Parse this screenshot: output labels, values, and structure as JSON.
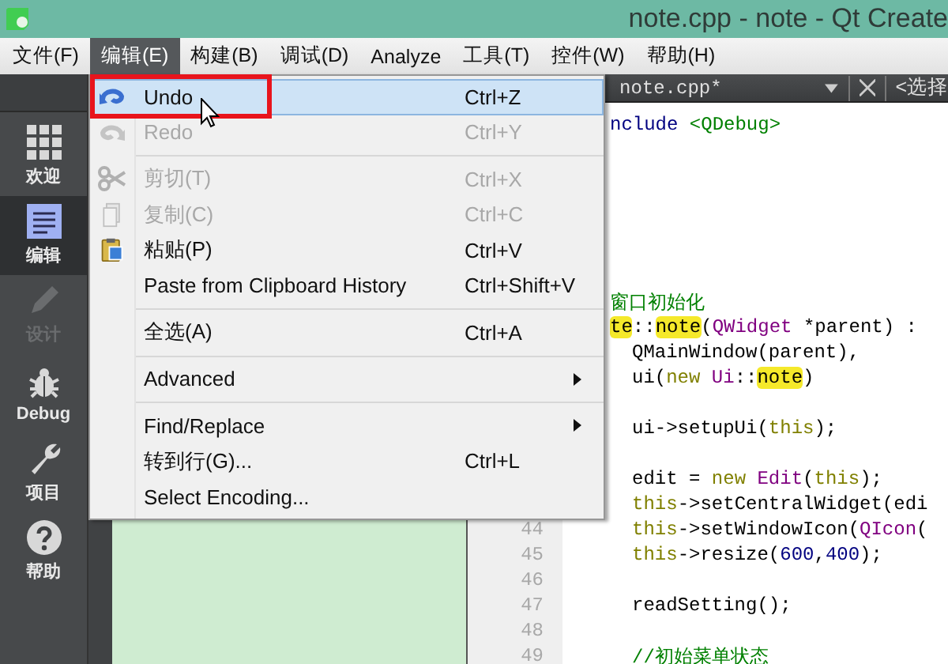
{
  "window": {
    "title": "note.cpp - note - Qt Create"
  },
  "menubar": [
    {
      "label": "文件(F)",
      "selected": false
    },
    {
      "label": "编辑(E)",
      "selected": true
    },
    {
      "label": "构建(B)",
      "selected": false
    },
    {
      "label": "调试(D)",
      "selected": false
    },
    {
      "label": "Analyze",
      "selected": false
    },
    {
      "label": "工具(T)",
      "selected": false
    },
    {
      "label": "控件(W)",
      "selected": false
    },
    {
      "label": "帮助(H)",
      "selected": false
    }
  ],
  "sidebar": [
    {
      "label": "欢迎",
      "selected": false,
      "disabled": false
    },
    {
      "label": "编辑",
      "selected": true,
      "disabled": false
    },
    {
      "label": "设计",
      "selected": false,
      "disabled": true
    },
    {
      "label": "Debug",
      "selected": false,
      "disabled": false
    },
    {
      "label": "项目",
      "selected": false,
      "disabled": false
    },
    {
      "label": "帮助",
      "selected": false,
      "disabled": false
    }
  ],
  "editor_toolbar": {
    "file": "note.cpp*",
    "symbol": "<选择"
  },
  "code_lines": [
    {
      "kind": "code",
      "segments": [
        {
          "kind": "preproc",
          "text": "nclude "
        },
        {
          "kind": "string",
          "text": "<QDebug>"
        }
      ]
    },
    {
      "kind": "blank"
    },
    {
      "kind": "blank"
    },
    {
      "kind": "blank"
    },
    {
      "kind": "blank"
    },
    {
      "kind": "blank"
    },
    {
      "kind": "blank"
    },
    {
      "kind": "code",
      "segments": [
        {
          "kind": "comment",
          "text": "窗口初始化"
        }
      ]
    },
    {
      "kind": "code",
      "segments": [
        {
          "kind": "match",
          "text": "te"
        },
        {
          "kind": "plain",
          "text": "::"
        },
        {
          "kind": "match",
          "text": "note"
        },
        {
          "kind": "plain",
          "text": "("
        },
        {
          "kind": "type",
          "text": "QWidget"
        },
        {
          "kind": "plain",
          "text": " *parent) :"
        }
      ]
    },
    {
      "kind": "indented",
      "segments": [
        {
          "kind": "plain",
          "text": "QMainWindow(parent),"
        }
      ]
    },
    {
      "kind": "indented",
      "segments": [
        {
          "kind": "plain",
          "text": "ui("
        },
        {
          "kind": "keyword",
          "text": "new "
        },
        {
          "kind": "type",
          "text": "Ui"
        },
        {
          "kind": "plain",
          "text": "::"
        },
        {
          "kind": "match",
          "text": "note"
        },
        {
          "kind": "plain",
          "text": ")"
        }
      ]
    },
    {
      "kind": "blank"
    },
    {
      "kind": "indented",
      "segments": [
        {
          "kind": "plain",
          "text": "ui->setupUi("
        },
        {
          "kind": "keyword",
          "text": "this"
        },
        {
          "kind": "plain",
          "text": ");"
        }
      ]
    },
    {
      "kind": "blank"
    },
    {
      "kind": "indented",
      "segments": [
        {
          "kind": "plain",
          "text": "edit = "
        },
        {
          "kind": "keyword",
          "text": "new "
        },
        {
          "kind": "type",
          "text": "Edit"
        },
        {
          "kind": "plain",
          "text": "("
        },
        {
          "kind": "keyword",
          "text": "this"
        },
        {
          "kind": "plain",
          "text": ");"
        }
      ]
    },
    {
      "kind": "indented",
      "segments": [
        {
          "kind": "keyword",
          "text": "this"
        },
        {
          "kind": "plain",
          "text": "->setCentralWidget(edi"
        }
      ]
    },
    {
      "kind": "indented",
      "number": "44",
      "segments": [
        {
          "kind": "keyword",
          "text": "this"
        },
        {
          "kind": "plain",
          "text": "->setWindowIcon("
        },
        {
          "kind": "type",
          "text": "QIcon"
        },
        {
          "kind": "plain",
          "text": "("
        }
      ]
    },
    {
      "kind": "indented",
      "number": "45",
      "segments": [
        {
          "kind": "keyword",
          "text": "this"
        },
        {
          "kind": "plain",
          "text": "->resize("
        },
        {
          "kind": "number",
          "text": "600"
        },
        {
          "kind": "plain",
          "text": ","
        },
        {
          "kind": "number",
          "text": "400"
        },
        {
          "kind": "plain",
          "text": ");"
        }
      ]
    },
    {
      "kind": "blank",
      "number": "46"
    },
    {
      "kind": "indented",
      "number": "47",
      "segments": [
        {
          "kind": "plain",
          "text": "readSetting();"
        }
      ]
    },
    {
      "kind": "blank",
      "number": "48"
    },
    {
      "kind": "indented",
      "number": "49",
      "segments": [
        {
          "kind": "comment",
          "text": "//初始菜单状态"
        }
      ]
    }
  ],
  "menu": [
    {
      "kind": "item",
      "label": "Undo",
      "shortcut": "Ctrl+Z",
      "selected": true,
      "disabled": false
    },
    {
      "kind": "item",
      "label": "Redo",
      "shortcut": "Ctrl+Y",
      "selected": false,
      "disabled": true
    },
    {
      "kind": "separator"
    },
    {
      "kind": "item",
      "label": "剪切(T)",
      "shortcut": "Ctrl+X",
      "selected": false,
      "disabled": true
    },
    {
      "kind": "item",
      "label": "复制(C)",
      "shortcut": "Ctrl+C",
      "selected": false,
      "disabled": true
    },
    {
      "kind": "item",
      "label": "粘贴(P)",
      "shortcut": "Ctrl+V",
      "selected": false,
      "disabled": false
    },
    {
      "kind": "item",
      "label": "Paste from Clipboard History",
      "shortcut": "Ctrl+Shift+V",
      "selected": false,
      "disabled": false
    },
    {
      "kind": "separator"
    },
    {
      "kind": "item",
      "label": "全选(A)",
      "shortcut": "Ctrl+A",
      "selected": false,
      "disabled": false
    },
    {
      "kind": "separator"
    },
    {
      "kind": "submenu",
      "label": "Advanced",
      "selected": false,
      "disabled": false
    },
    {
      "kind": "separator"
    },
    {
      "kind": "submenu",
      "label": "Find/Replace",
      "selected": false,
      "disabled": false
    },
    {
      "kind": "item",
      "label": "转到行(G)...",
      "shortcut": "Ctrl+L",
      "selected": false,
      "disabled": false
    },
    {
      "kind": "item",
      "label": "Select Encoding...",
      "selected": false,
      "disabled": false
    }
  ]
}
